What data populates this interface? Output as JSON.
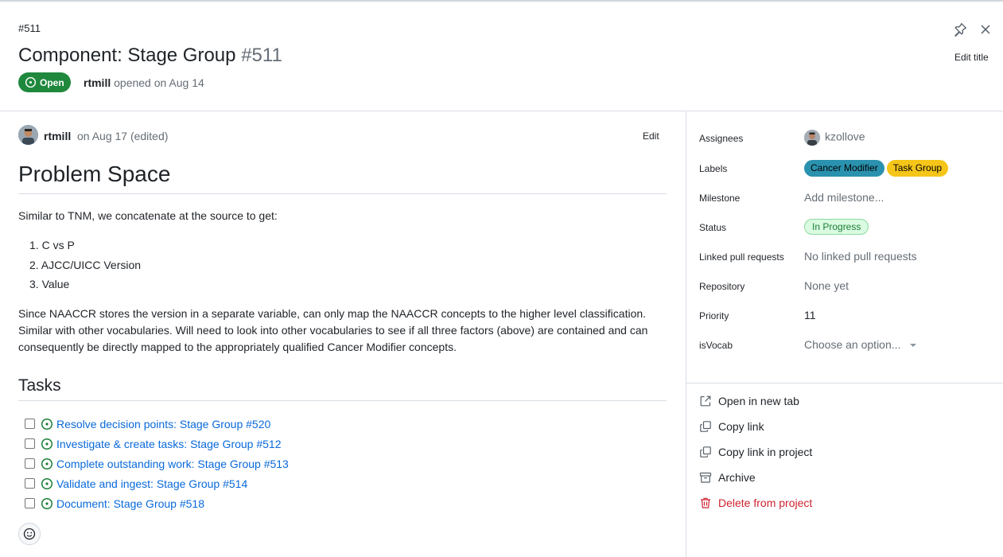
{
  "header": {
    "issue_ref": "#511",
    "title": "Component: Stage Group",
    "number": "#511",
    "state": "Open",
    "author": "rtmill",
    "opened_text": "opened on Aug 14",
    "edit_title_label": "Edit title",
    "pin_icon": "pin-icon",
    "close_icon": "close-icon"
  },
  "comment": {
    "author": "rtmill",
    "date_text": "on Aug 17 (edited)",
    "edit_label": "Edit",
    "heading": "Problem Space",
    "intro": "Similar to TNM, we concatenate at the source to get:",
    "list": [
      "C vs P",
      "AJCC/UICC Version",
      "Value"
    ],
    "paragraph": "Since NAACCR stores the version in a separate variable, can only map the NAACCR concepts to the higher level classification. Similar with other vocabularies. Will need to look into other vocabularies to see if all three factors (above) are contained and can consequently be directly mapped to the appropriately qualified Cancer Modifier concepts.",
    "tasks_heading": "Tasks",
    "tasks": [
      {
        "label": "Resolve decision points: Stage Group #520",
        "checked": false
      },
      {
        "label": "Investigate & create tasks: Stage Group #512",
        "checked": false
      },
      {
        "label": "Complete outstanding work: Stage Group #513",
        "checked": false
      },
      {
        "label": "Validate and ingest: Stage Group #514",
        "checked": false
      },
      {
        "label": "Document: Stage Group #518",
        "checked": false
      }
    ],
    "emoji_icon": "smiley-icon"
  },
  "sidebar": {
    "assignees_label": "Assignees",
    "assignee": "kzollove",
    "labels_label": "Labels",
    "labels": [
      "Cancer Modifier",
      "Task Group"
    ],
    "milestone_label": "Milestone",
    "milestone_value": "Add milestone...",
    "status_label": "Status",
    "status_value": "In Progress",
    "linked_pr_label": "Linked pull requests",
    "linked_pr_value": "No linked pull requests",
    "repository_label": "Repository",
    "repository_value": "None yet",
    "priority_label": "Priority",
    "priority_value": "11",
    "isvocab_label": "isVocab",
    "isvocab_value": "Choose an option..."
  },
  "actions": [
    {
      "label": "Open in new tab",
      "icon": "external-link-icon"
    },
    {
      "label": "Copy link",
      "icon": "copy-icon"
    },
    {
      "label": "Copy link in project",
      "icon": "copy-icon"
    },
    {
      "label": "Archive",
      "icon": "archive-icon"
    },
    {
      "label": "Delete from project",
      "icon": "trash-icon"
    }
  ],
  "colors": {
    "open_green": "#1f883d",
    "link_blue": "#0969da",
    "danger_red": "#cf222e",
    "label_cancer": "#2a92ae",
    "label_task": "#f5c518"
  }
}
